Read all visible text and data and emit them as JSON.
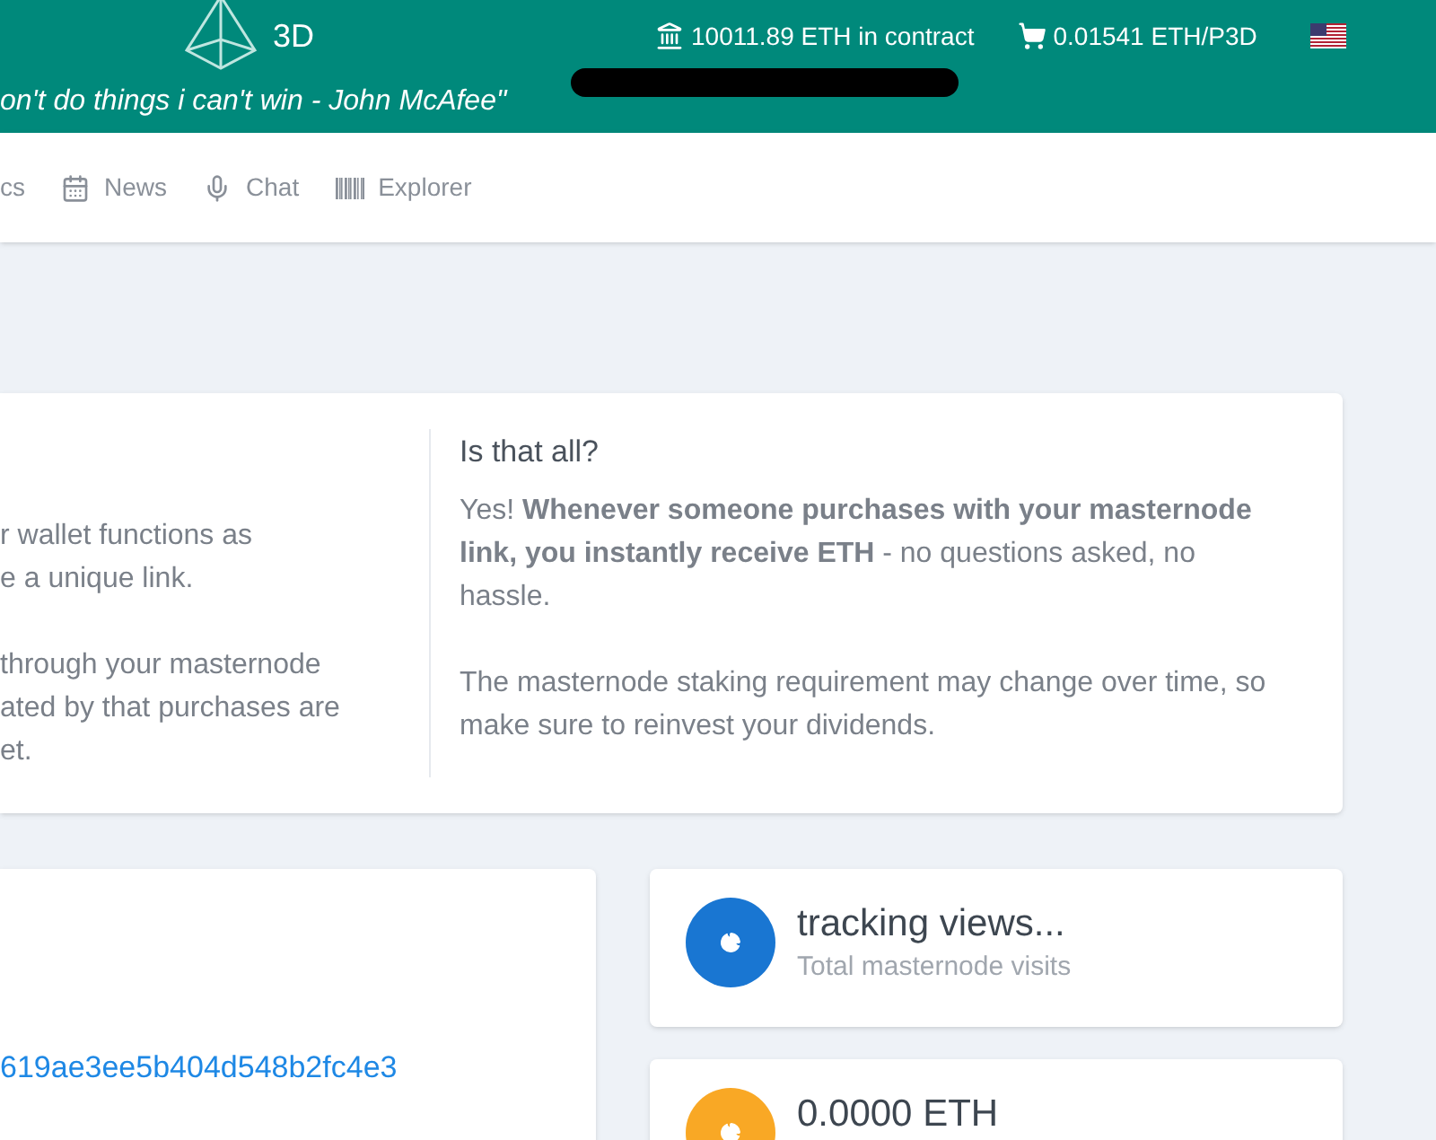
{
  "header": {
    "logo_text": "3D",
    "quote": "on't do things i can't win - John McAfee\"",
    "contract": "10011.89 ETH in contract",
    "price": "0.01541 ETH/P3D"
  },
  "nav": [
    {
      "label": "cs",
      "kind": "plain"
    },
    {
      "label": "News",
      "kind": "news"
    },
    {
      "label": "Chat",
      "kind": "chat"
    },
    {
      "label": "Explorer",
      "kind": "explorer"
    }
  ],
  "info_card": {
    "left_paragraphs": [
      [
        "r wallet functions as",
        "e a unique link."
      ],
      [
        "through your masternode",
        "ated by that purchases are",
        "et."
      ]
    ],
    "right_title": "Is that all?",
    "right_paragraphs": [
      "Yes! **Whenever someone purchases with your masternode link, you instantly receive ETH** - no questions asked, no hassle.",
      "The masternode staking requirement may change over time, so make sure to reinvest your dividends."
    ]
  },
  "link_card": {
    "link": "619ae3ee5b404d548b2fc4e3"
  },
  "stats": [
    {
      "title": "tracking views...",
      "subtitle": "Total masternode visits",
      "color": "#1976d2"
    },
    {
      "title": "0.0000 ETH",
      "color": "#f9a825"
    }
  ]
}
